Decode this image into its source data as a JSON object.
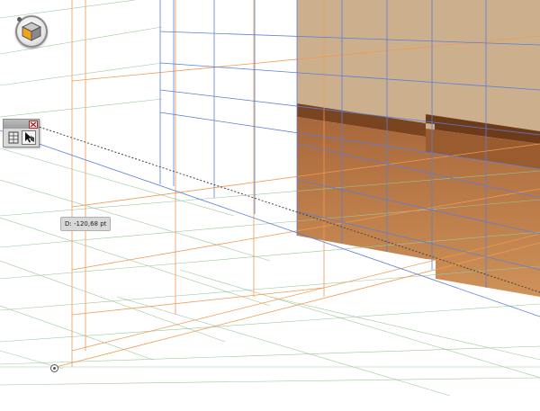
{
  "canvas": {
    "distance_readout": "D: -120,68 pt"
  },
  "widget": {
    "icon": "perspective-cube-icon",
    "colors": {
      "left": "#f2a21b",
      "top": "#c7c7c7",
      "right": "#8a8a8a"
    }
  },
  "tool_panel": {
    "tools": [
      {
        "icon": "perspective-grid-tool-icon"
      },
      {
        "icon": "perspective-selection-tool-icon",
        "selected": true
      }
    ],
    "close_icon": "close-icon"
  },
  "colors": {
    "grid_green": "#9cc99a",
    "grid_orange": "#f09a52",
    "grid_blue": "#5b7fd6",
    "surface_tan": "#ccb08e",
    "surface_dark": "#7a4420",
    "surface_mid": "#a8673a",
    "surface_light": "#c98a55"
  }
}
